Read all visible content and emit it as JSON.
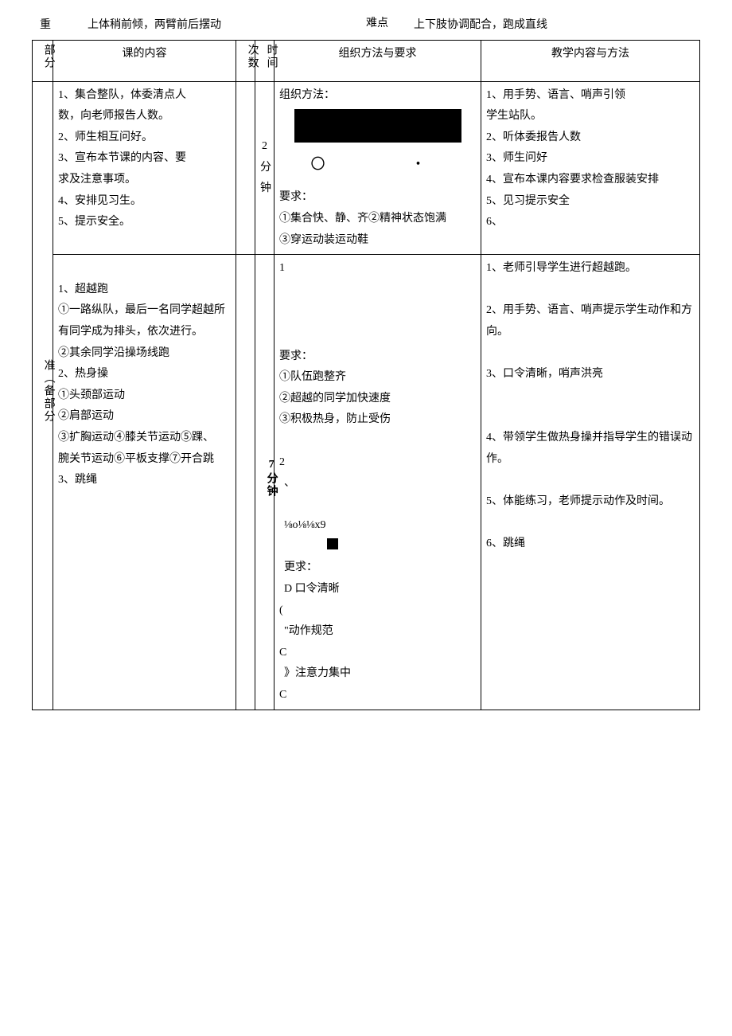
{
  "top": {
    "label_left": "重",
    "text_left": "上体稍前倾，两臂前后摆动",
    "label_right": "难点",
    "text_right": "上下肢协调配合，跑成直线"
  },
  "headers": {
    "part": "部分",
    "content": "课的内容",
    "count": "次数",
    "time": "时间",
    "org": "组织方法与要求",
    "teach": "教学内容与方法"
  },
  "row1": {
    "content_l1": "1、集合整队，体委清点人",
    "content_l2": "数，向老师报告人数。",
    "content_l3": "2、师生相互问好。",
    "content_l4": "3、宣布本节课的内容、要",
    "content_l5": "求及注意事项。",
    "content_l6": "4、安排见习生。",
    "content_l7": "5、提示安全。",
    "time": "2分钟",
    "org_title": "组织方法：",
    "org_symbols": "〇　　・",
    "org_req_label": "要求：",
    "org_req1": "①集合快、静、齐②精神状态饱满",
    "org_req2": "③穿运动装运动鞋",
    "teach_l1": "1、用手势、语言、哨声引领",
    "teach_l2": "学生站队。",
    "teach_l3": "2、听体委报告人数",
    "teach_l4": "3、师生问好",
    "teach_l5": "4、宣布本课内容要求检查服装安排",
    "teach_l6": "5、见习提示安全",
    "teach_l7": "6、"
  },
  "row2": {
    "part_label": "准︵备部分",
    "content_l1": "1、超越跑",
    "content_l2": "①一路纵队，最后一名同学超越所有同学成为排头，依次进行。",
    "content_l3": "②其余同学沿操场线跑",
    "content_l4": "2、热身操",
    "content_l5": "①头颈部运动",
    "content_l6": "②肩部运动",
    "content_l7": "③扩胸运动④膝关节运动⑤踝、",
    "content_l8": "腕关节运动⑥平板支撑⑦开合跳",
    "content_l9": "3、跳绳",
    "time": "7分钟",
    "org_n1": "1",
    "org_req_label": "要求：",
    "org_req1": "①队伍跑整齐",
    "org_req2": "②超越的同学加快速度",
    "org_req3": "③积极热身，防止受伤",
    "org_n2": "2",
    "org_sep": "、",
    "org_code": "⅛o⅛⅛x9",
    "org_more_label": "更求：",
    "org_more1": "D 口令清晰",
    "org_more_prefix": "(",
    "org_more2": "\"动作规范",
    "org_more_c1": "C",
    "org_more3": "》注意力集中",
    "org_more_c2": "C",
    "teach_l1": "1、老师引导学生进行超越跑。",
    "teach_l2": "2、用手势、语言、哨声提示学生动作和方向。",
    "teach_l3": "3、口令清晰，哨声洪亮",
    "teach_l4": "4、带领学生做热身操并指导学生的错误动作。",
    "teach_l5": "5、体能练习，老师提示动作及时间。",
    "teach_l6": "6、跳绳"
  }
}
